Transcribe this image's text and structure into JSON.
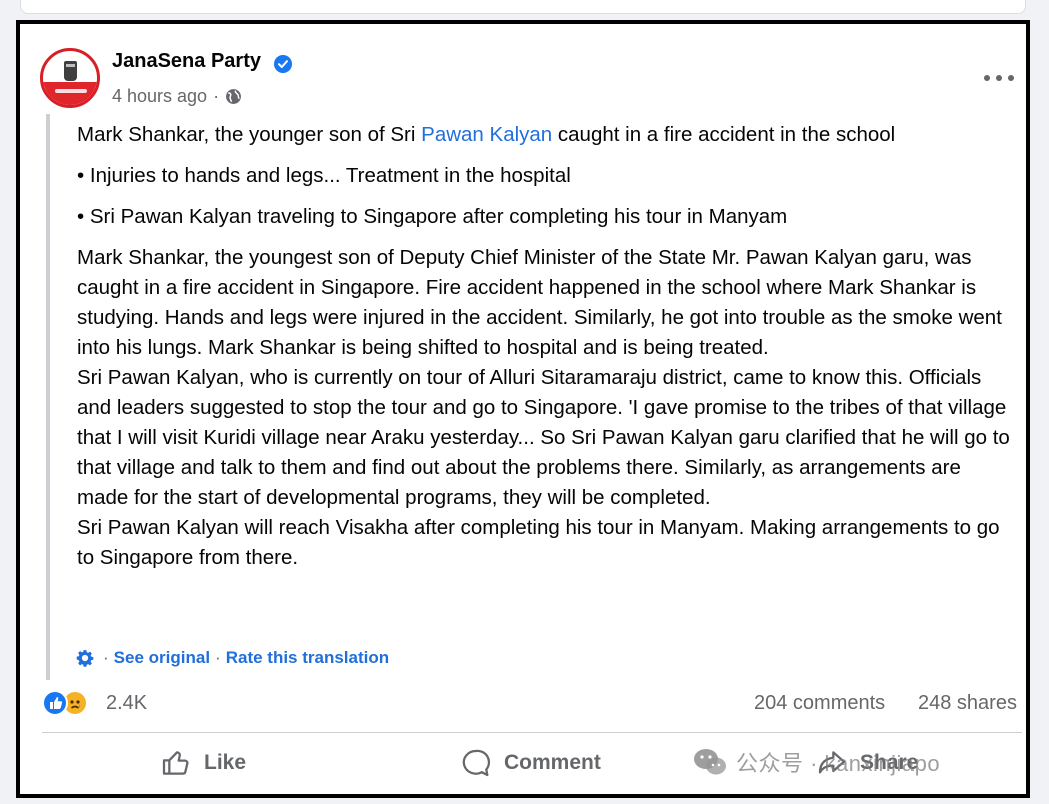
{
  "post": {
    "page_name": "JanaSena Party",
    "time": "4 hours ago",
    "separator": "·",
    "body": {
      "line1_prefix": "Mark Shankar, the younger son of Sri ",
      "line1_link": "Pawan Kalyan",
      "line1_suffix": " caught in a fire accident in the school",
      "bullet1": "• Injuries to hands and legs... Treatment in the hospital",
      "bullet2": "• Sri Pawan Kalyan traveling to Singapore after completing his tour in Manyam",
      "para1": "Mark Shankar, the youngest son of Deputy Chief Minister of the State Mr. Pawan Kalyan garu, was caught in a fire accident in Singapore. Fire accident happened in the school where Mark Shankar is studying. Hands and legs were injured in the accident. Similarly, he got into trouble as the smoke went into his lungs. Mark Shankar is being shifted to hospital and is being treated.",
      "para2": "Sri Pawan Kalyan, who is currently on tour of Alluri Sitaramaraju district, came to know this. Officials and leaders suggested to stop the tour and go to Singapore. 'I gave promise to the tribes of that village that I will visit Kuridi village near Araku yesterday... So Sri Pawan Kalyan garu clarified that he will go to that village and talk to them and find out about the problems there. Similarly, as arrangements are made for the start of developmental programs, they will be completed.",
      "para3": "Sri Pawan Kalyan will reach Visakha after completing his tour in Manyam. Making arrangements to go to Singapore from there."
    },
    "translation": {
      "see_original": "See original",
      "rate": "Rate this translation",
      "separator": "·"
    }
  },
  "stats": {
    "reactions": "2.4K",
    "comments": "204 comments",
    "shares": "248 shares"
  },
  "actions": {
    "like": "Like",
    "comment": "Comment",
    "share": "Share"
  },
  "watermark": {
    "text": "公众号 · kanxinjiapo"
  },
  "colors": {
    "link": "#216fdb",
    "verified": "#1877f2",
    "muted": "#65676b"
  }
}
